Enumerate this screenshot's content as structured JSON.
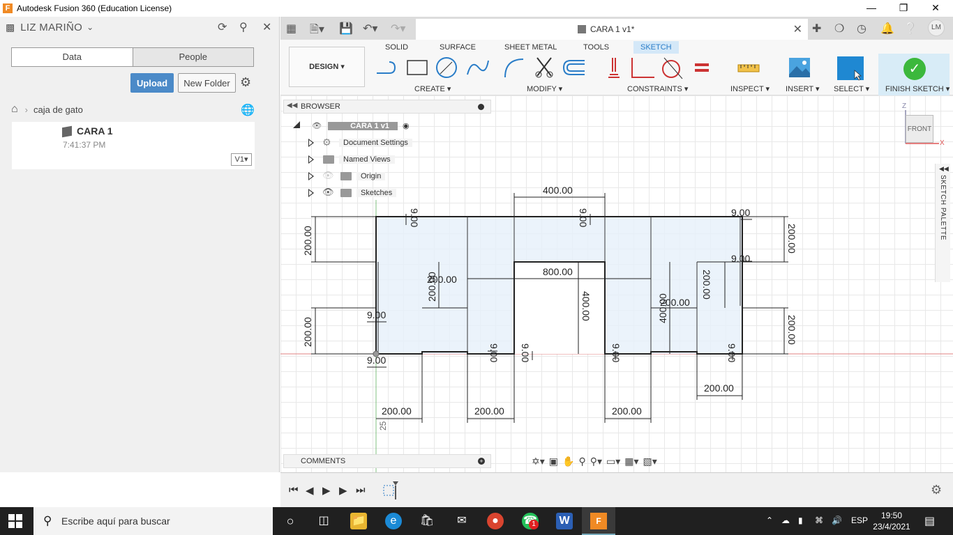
{
  "window": {
    "title": "Autodesk Fusion 360 (Education License)",
    "app_icon_letter": "F"
  },
  "data_panel": {
    "user_name": "LIZ MARIÑO",
    "tabs": [
      "Data",
      "People"
    ],
    "upload_label": "Upload",
    "new_folder_label": "New Folder",
    "breadcrumb": "caja de gato",
    "file": {
      "name": "CARA 1",
      "time": "7:41:37 PM",
      "version": "V1"
    }
  },
  "doc_tab": {
    "label": "CARA 1 v1*"
  },
  "user_initials": "LM",
  "toolbar": {
    "workspace": "DESIGN",
    "tabs": [
      "SOLID",
      "SURFACE",
      "SHEET METAL",
      "TOOLS",
      "SKETCH"
    ],
    "active_tab": "SKETCH",
    "groups": [
      "CREATE",
      "MODIFY",
      "CONSTRAINTS",
      "INSPECT",
      "INSERT",
      "SELECT"
    ],
    "finish_label": "FINISH SKETCH"
  },
  "browser": {
    "title": "BROWSER",
    "root": "CARA 1 v1",
    "nodes": [
      "Document Settings",
      "Named Views",
      "Origin",
      "Sketches"
    ]
  },
  "comments_label": "COMMENTS",
  "viewcube": {
    "face": "FRONT",
    "z": "Z",
    "x": "X"
  },
  "sketch_palette_label": "SKETCH PALETTE",
  "dimensions": {
    "top_width": "400.00",
    "left_height": "200.00",
    "right_height_top": "200.00",
    "right_height_bottom": "200.00",
    "left_height_bottom": "200.00",
    "center_width": "800.00",
    "inner_left_height": "200.00",
    "inner_left_width": "200.00",
    "center_height": "400.00",
    "inner_right_height": "200.00",
    "inner_right_width": "200.00",
    "inner_right_height2": "400.00",
    "thickness": "9.00",
    "bottom_left_width": "200.00",
    "bottom_mid_width": "200.00",
    "bottom_right_width": "200.00",
    "lower_right_width": "200.00",
    "partial_vertical": "25"
  },
  "taskbar": {
    "search_placeholder": "Escribe aquí para buscar",
    "lang": "ESP",
    "time": "19:50",
    "date": "23/4/2021",
    "whatsapp_badge": "1"
  }
}
